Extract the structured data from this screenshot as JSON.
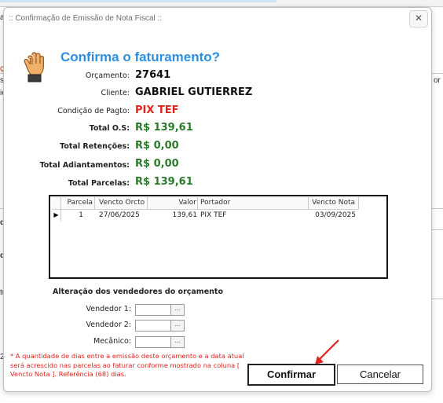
{
  "dialog": {
    "title": ":: Confirmação de Emissão de Nota Fiscal ::",
    "close": "✕",
    "heading": "Confirma o faturamento?"
  },
  "fields": [
    {
      "label": "Orçamento:",
      "value": "27641"
    },
    {
      "label": "Cliente:",
      "value": "GABRIEL GUTIERREZ"
    },
    {
      "label": "Condição de Pagto:",
      "value": "PIX TEF"
    },
    {
      "label": "Total O.S:",
      "value": "R$ 139,61"
    },
    {
      "label": "Total Retenções:",
      "value": "R$ 0,00"
    },
    {
      "label": "Total Adiantamentos:",
      "value": "R$ 0,00"
    },
    {
      "label": "Total Parcelas:",
      "value": "R$ 139,61"
    }
  ],
  "grid": {
    "headers": [
      "Parcela",
      "Vencto Orcto",
      "Valor",
      "Portador",
      "Vencto Nota"
    ],
    "rows": [
      [
        "1",
        "27/06/2025",
        "139,61",
        "PIX TEF",
        "03/09/2025"
      ]
    ],
    "row_indicator": "▶"
  },
  "vendedores": {
    "section_title": "Alteração dos vendedores do orçamento",
    "items": [
      {
        "label": "Vendedor 1:",
        "value": "",
        "button": "..."
      },
      {
        "label": "Vendedor 2:",
        "value": "",
        "button": "..."
      },
      {
        "label": "Mecânico:",
        "value": "",
        "button": "..."
      }
    ]
  },
  "note": "* A quantidade de dias entre a emissão deste orçamento e a data atual será acrescido nas parcelas ao faturar conforme mostrado na coluna [ Vencto Nota ]. Referência (68) dias.",
  "buttons": {
    "confirm": "Confirmar",
    "cancel": "Cancelar"
  },
  "background": {
    "frag_a": "a",
    "frag_c": "ç",
    "frag_s": "s",
    "frag_ic": "ic",
    "frag_or": "or",
    "frag_d1": "d",
    "frag_d2": "d",
    "frag_tu": "tu",
    "frag_2": "2"
  },
  "colors": {
    "heading": "#2d8fe0",
    "red_value": "#e0231c",
    "green_value": "#2a7a2a",
    "arrow": "#e0231c"
  }
}
